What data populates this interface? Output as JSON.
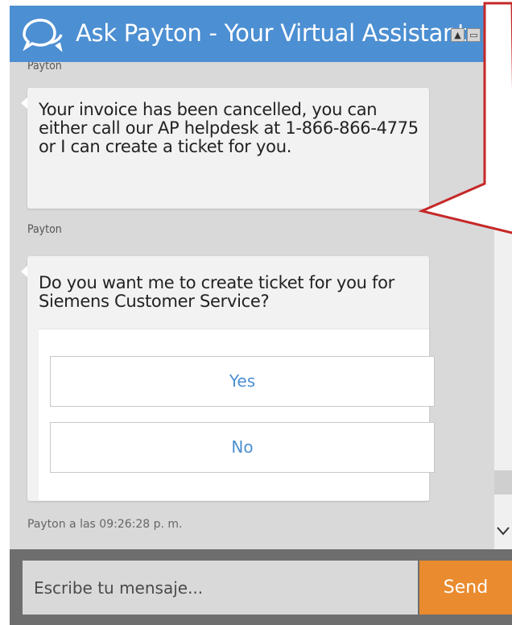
{
  "header": {
    "title": "Ask Payton - Your Virtual Assistant",
    "logo_icon": "chat-bubbles-icon",
    "minimize_symbol": "▲",
    "maximize_symbol": "▭",
    "close_symbol": "×"
  },
  "chat": {
    "top_sender": "Payton",
    "messages": [
      {
        "sender": "Payton",
        "text": "Your invoice has been cancelled, you can either call our AP helpdesk at 1-866-866-4775 or I can create a ticket for you."
      },
      {
        "sender": "Payton",
        "text": "Do you want me to create ticket for you for Siemens Customer Service?",
        "options": [
          "Yes",
          "No"
        ]
      }
    ],
    "timestamp": "Payton a las 09:26:28 p. m."
  },
  "input": {
    "placeholder": "Escribe tu mensaje...",
    "send_label": "Send"
  },
  "colors": {
    "header": "#4c8fd2",
    "send": "#e98b2e",
    "option_text": "#4c8fd2",
    "callout": "#c62828"
  }
}
